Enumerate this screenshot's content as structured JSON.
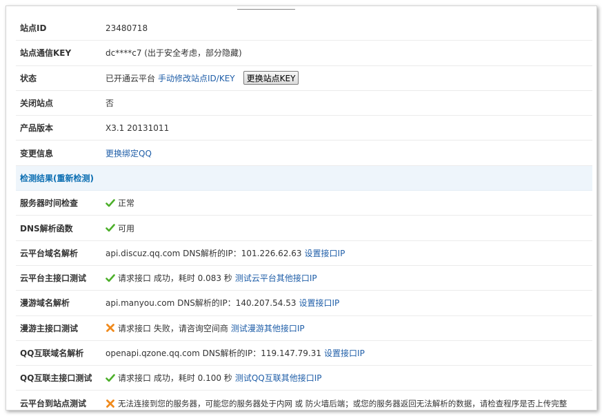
{
  "rows": [
    {
      "label": "站点ID",
      "value": "23480718"
    },
    {
      "label": "站点通信KEY",
      "value": "dc****c7 (出于安全考虑，部分隐藏)"
    },
    {
      "label": "状态",
      "text": "已开通云平台",
      "link": "手动修改站点ID/KEY",
      "button": "更换站点KEY"
    },
    {
      "label": "关闭站点",
      "value": "否"
    },
    {
      "label": "产品版本",
      "value": "X3.1 20131011"
    },
    {
      "label": "变更信息",
      "link": "更换绑定QQ"
    }
  ],
  "section": {
    "title": "检测结果(",
    "link": "重新检测",
    "suffix": ")"
  },
  "checks": [
    {
      "label": "服务器时间检查",
      "status": "ok",
      "icon": "check-icon",
      "text": "正常"
    },
    {
      "label": "DNS解析函数",
      "status": "ok",
      "icon": "check-icon",
      "text": "可用"
    },
    {
      "label": "云平台域名解析",
      "text": "api.discuz.qq.com DNS解析的IP：101.226.62.63",
      "link": "设置接口IP"
    },
    {
      "label": "云平台主接口测试",
      "status": "ok",
      "icon": "check-icon",
      "text": "请求接口 成功，耗时 0.083 秒",
      "link": "测试云平台其他接口IP"
    },
    {
      "label": "漫游域名解析",
      "text": "api.manyou.com DNS解析的IP：140.207.54.53",
      "link": "设置接口IP"
    },
    {
      "label": "漫游主接口测试",
      "status": "fail",
      "icon": "cross-icon",
      "text": "请求接口 失败，请咨询空间商",
      "link": "测试漫游其他接口IP"
    },
    {
      "label": "QQ互联域名解析",
      "text": "openapi.qzone.qq.com DNS解析的IP：119.147.79.31",
      "link": "设置接口IP"
    },
    {
      "label": "QQ互联主接口测试",
      "status": "ok",
      "icon": "check-icon",
      "text": "请求接口 成功，耗时 0.100 秒",
      "link": "测试QQ互联其他接口IP"
    },
    {
      "label": "云平台到站点测试",
      "status": "fail",
      "icon": "cross-icon",
      "text": "无法连接到您的服务器，可能您的服务器处于内网 或 防火墙后端；或您的服务器返回无法解析的数据，请检查程序是否上传完整"
    }
  ],
  "colors": {
    "ok": "#4caf2a",
    "fail": "#f08a1c",
    "link": "#1f5ea8",
    "section_bg": "#eef5fb"
  }
}
